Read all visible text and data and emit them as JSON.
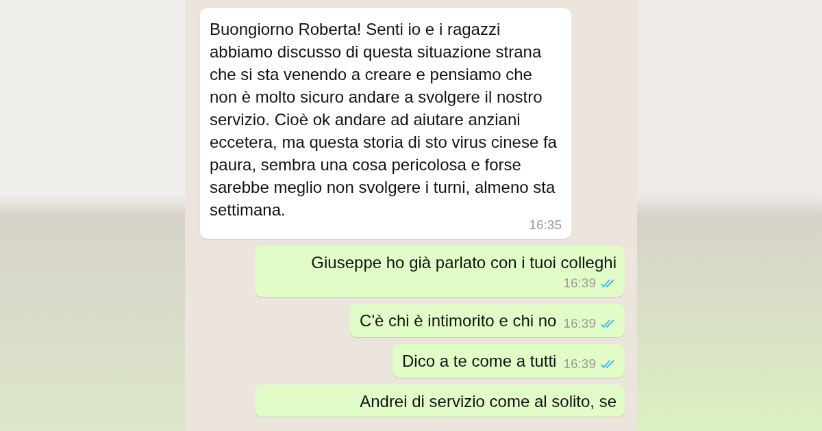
{
  "messages": [
    {
      "kind": "incoming",
      "text": "Buongiorno Roberta! Senti io e i ragazzi abbiamo discusso di questa situazione strana che si sta venendo a creare e pensiamo che non è molto sicuro andare a svolgere il nostro servizio. Cioè ok andare ad aiutare anziani eccetera, ma questa storia di sto virus cinese fa paura, sembra una cosa pericolosa e forse sarebbe meglio non svolgere i turni, almeno sta settimana.",
      "time": "16:35"
    },
    {
      "kind": "outgoing",
      "text": "Giuseppe ho già parlato con i tuoi colleghi",
      "time": "16:39",
      "read": true
    },
    {
      "kind": "outgoing",
      "text": "C'è chi è intimorito e chi no",
      "time": "16:39",
      "read": true
    },
    {
      "kind": "outgoing",
      "text": "Dico a te come a tutti",
      "time": "16:39",
      "read": true
    },
    {
      "kind": "outgoing",
      "text": "Andrei di servizio come al solito, se"
    }
  ]
}
